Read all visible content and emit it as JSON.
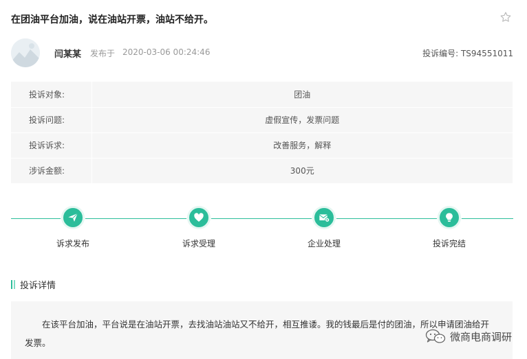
{
  "header": {
    "title": "在团油平台加油，说在油站开票，油站不给开。",
    "favorite_icon": "star-outline-icon"
  },
  "author": {
    "name": "闫某某",
    "published_label": "发布于",
    "published_time": "2020-03-06 00:24:46",
    "complaint_no": "投诉编号: TS94551011"
  },
  "info": {
    "rows": [
      {
        "label": "投诉对象:",
        "value": "团油"
      },
      {
        "label": "投诉问题:",
        "value": "虚假宣传，发票问题"
      },
      {
        "label": "投诉诉求:",
        "value": "改善服务，解释"
      },
      {
        "label": "涉诉金额:",
        "value": "300元"
      }
    ]
  },
  "progress": {
    "accent": "#2bbd9a",
    "steps": [
      {
        "label": "诉求发布",
        "icon": "paper-plane-icon"
      },
      {
        "label": "诉求受理",
        "icon": "heart-icon"
      },
      {
        "label": "企业处理",
        "icon": "mail-reply-icon"
      },
      {
        "label": "投诉完结",
        "icon": "lightbulb-icon"
      }
    ]
  },
  "detail": {
    "section_title": "投诉详情",
    "text": "在该平台加油，平台说是在油站开票，去找油站油站又不给开，相互推诿。我的钱最后是付的团油，所以申请团油给开发票。"
  },
  "watermark": {
    "text": "微商电商调研",
    "icon": "wechat-icon"
  }
}
